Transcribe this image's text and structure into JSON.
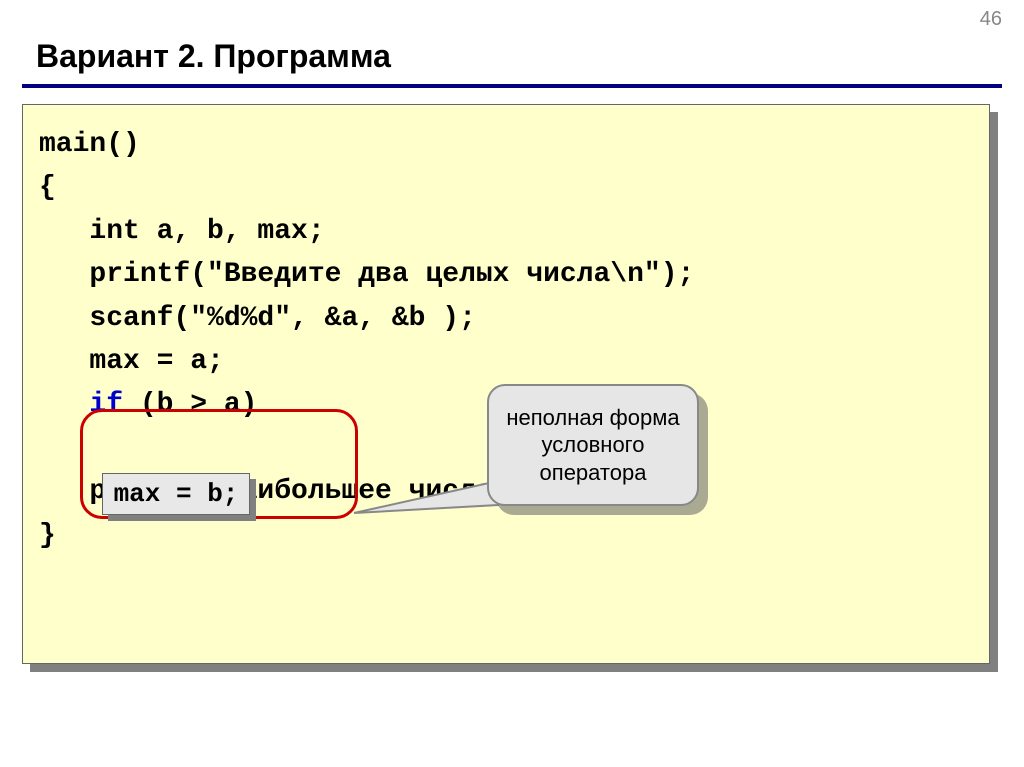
{
  "page_number": "46",
  "title": "Вариант 2. Программа",
  "code": {
    "l1": "main()",
    "l2": "{",
    "l3": "   int a, b, max;",
    "l4": "   printf(\"Введите два целых числа\\n\");",
    "l5": "   scanf(\"%d%d\", &a, &b );",
    "l6": "   max = a;",
    "l7a": "   ",
    "l7kw": "if",
    "l7b": " (b > a)",
    "l8": " ",
    "l9": "   printf(\"Наибольшее число %d\", max);",
    "l10": "}"
  },
  "highlight_box": "max = b;",
  "callout_text": "неполная форма условного оператора"
}
